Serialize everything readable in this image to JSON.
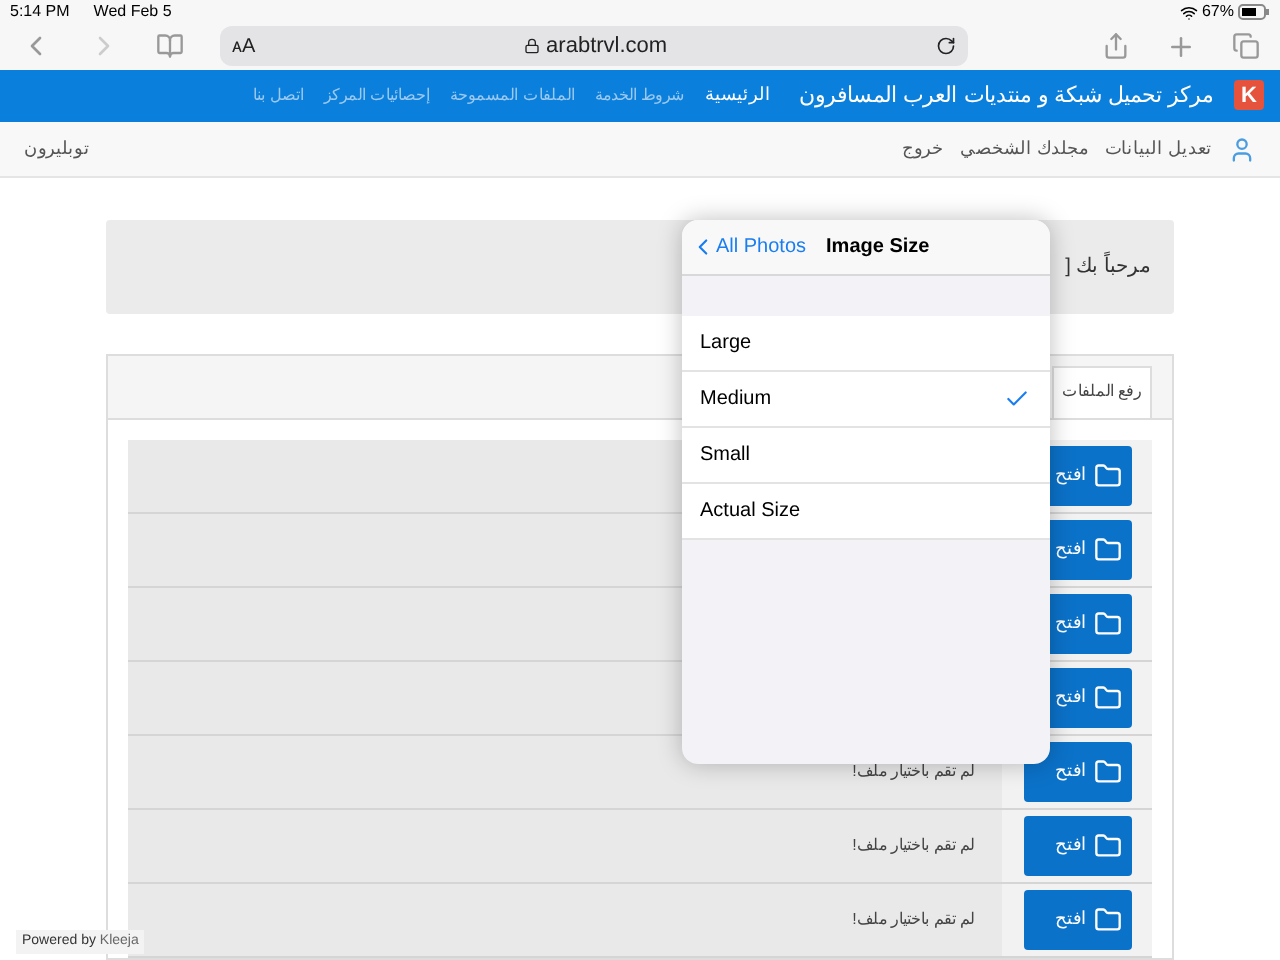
{
  "status_bar": {
    "time": "5:14 PM",
    "date": "Wed Feb 5",
    "battery": "67%"
  },
  "browser": {
    "text_size": "ᴀA",
    "url": "arabtrvl.com"
  },
  "site_nav": {
    "logo": "K",
    "title": "مركز تحميل شبكة و منتديات العرب المسافرون",
    "links": [
      {
        "label": "الرئيسية",
        "selected": true
      },
      {
        "label": "شروط الخدمة",
        "selected": false
      },
      {
        "label": "الملفات المسموحة",
        "selected": false
      },
      {
        "label": "إحصائيات المركز",
        "selected": false
      },
      {
        "label": "اتصل بنا",
        "selected": false
      }
    ]
  },
  "user_bar": {
    "links": [
      "تعديل البيانات",
      "مجلدك الشخصي",
      "خروج"
    ],
    "username": "توبليرون"
  },
  "welcome": "مرحباً بك [",
  "tabs": [
    {
      "label": "رفع الملفات",
      "selected": true
    }
  ],
  "rows": [
    {
      "button": "افتح"
    },
    {
      "button": "افتح"
    },
    {
      "button": "افتح"
    },
    {
      "button": "افتح"
    },
    {
      "button": "افتح",
      "status": "لم تقم باختيار ملف!"
    },
    {
      "button": "افتح",
      "status": "لم تقم باختيار ملف!"
    },
    {
      "button": "افتح",
      "status": "لم تقم باختيار ملف!"
    }
  ],
  "popover": {
    "back": "All Photos",
    "title": "Image Size",
    "options": [
      {
        "label": "Large",
        "selected": false
      },
      {
        "label": "Medium",
        "selected": true
      },
      {
        "label": "Small",
        "selected": false
      },
      {
        "label": "Actual Size",
        "selected": false
      }
    ]
  },
  "footer": {
    "prefix": "Powered by",
    "link": "Kleeja"
  }
}
